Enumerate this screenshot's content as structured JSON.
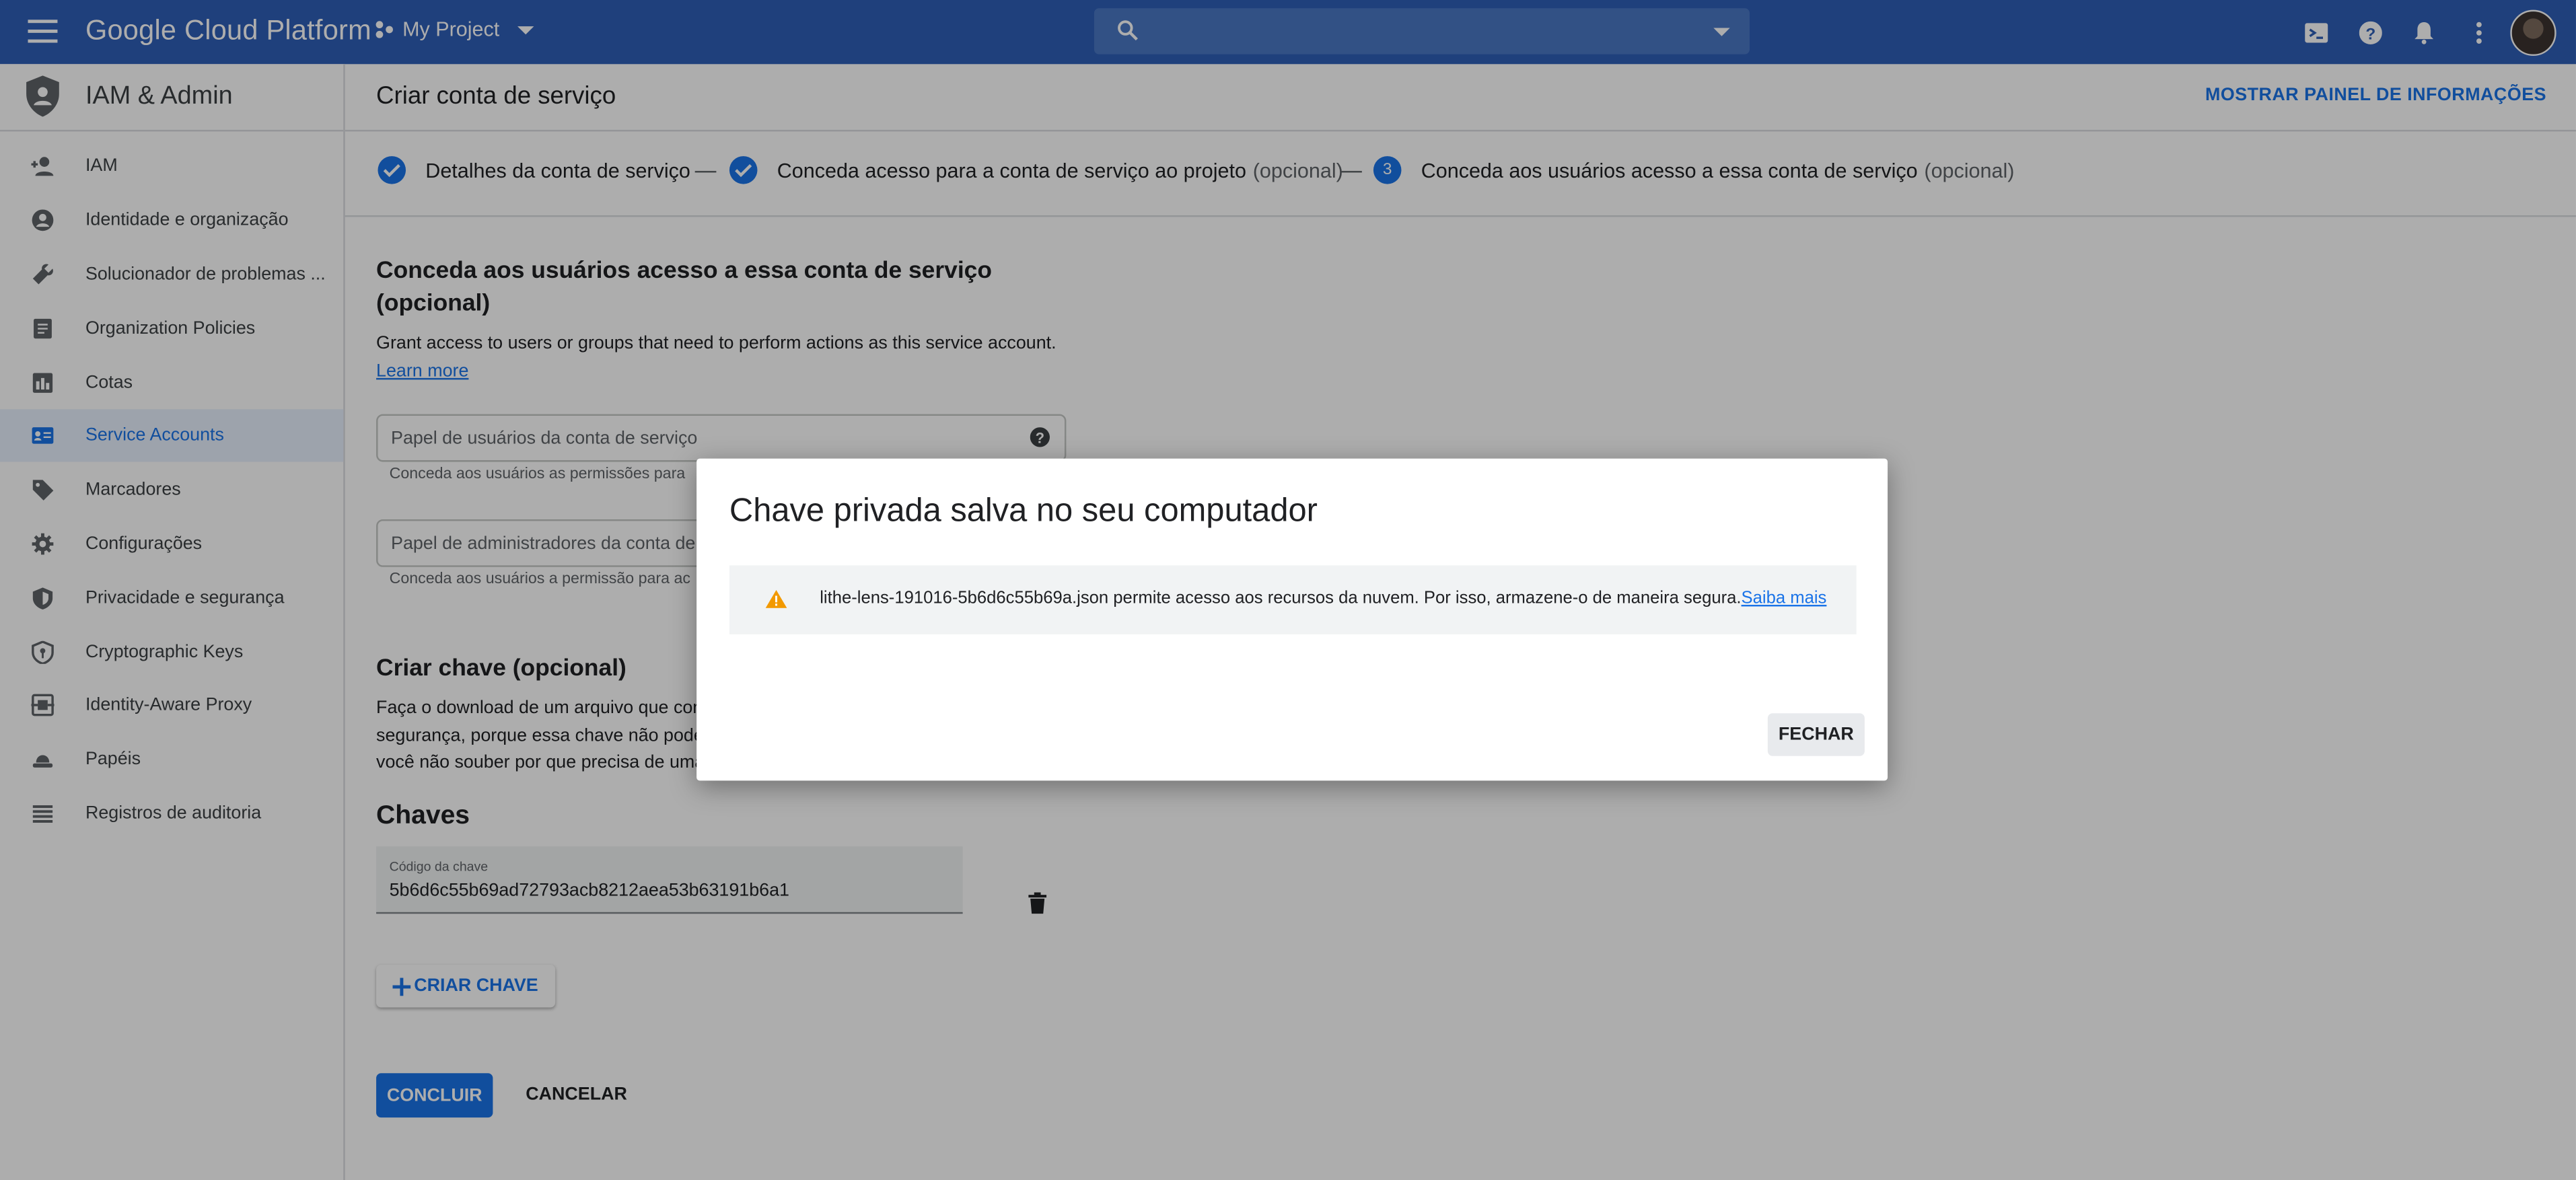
{
  "topbar": {
    "brand": "Google Cloud Platform",
    "project": "My Project"
  },
  "sidebar": {
    "section_title": "IAM & Admin",
    "items": [
      {
        "label": "IAM",
        "icon": "person-add-icon"
      },
      {
        "label": "Identidade e organização",
        "icon": "account-circle-icon"
      },
      {
        "label": "Solucionador de problemas ...",
        "icon": "wrench-icon"
      },
      {
        "label": "Organization Policies",
        "icon": "document-icon"
      },
      {
        "label": "Cotas",
        "icon": "quota-icon"
      },
      {
        "label": "Service Accounts",
        "icon": "service-account-icon",
        "active": true
      },
      {
        "label": "Marcadores",
        "icon": "tag-icon"
      },
      {
        "label": "Configurações",
        "icon": "gear-icon"
      },
      {
        "label": "Privacidade e segurança",
        "icon": "shield-icon"
      },
      {
        "label": "Cryptographic Keys",
        "icon": "key-shield-icon"
      },
      {
        "label": "Identity-Aware Proxy",
        "icon": "proxy-icon"
      },
      {
        "label": "Papéis",
        "icon": "hat-icon"
      },
      {
        "label": "Registros de auditoria",
        "icon": "list-icon"
      }
    ]
  },
  "main": {
    "title": "Criar conta de serviço",
    "info_button": "MOSTRAR PAINEL DE INFORMAÇÕES",
    "steps": [
      {
        "label": "Detalhes da conta de serviço",
        "optional": ""
      },
      {
        "label": "Conceda acesso para a conta de serviço ao projeto",
        "optional": "(opcional)"
      },
      {
        "label": "Conceda aos usuários acesso a essa conta de serviço",
        "optional": "(opcional)",
        "number": "3"
      }
    ],
    "section_title_line1": "Conceda aos usuários acesso a essa conta de serviço",
    "section_title_line2": "(opcional)",
    "section_desc": "Grant access to users or groups that need to perform actions as this service account.",
    "learn_more": "Learn more",
    "users_role_placeholder": "Papel de usuários da conta de serviço",
    "users_role_hint": "Conceda aos usuários as permissões para",
    "admins_role_placeholder": "Papel de administradores da conta de s",
    "admins_role_hint": "Conceda aos usuários a permissão para ac",
    "create_key_title": "Criar chave (opcional)",
    "create_key_desc_1": "Faça o download de um arquivo que cont",
    "create_key_desc_2": "segurança, porque essa chave não poderá",
    "create_key_desc_3": "você não souber por que precisa de uma",
    "keys_title": "Chaves",
    "key_label": "Código da chave",
    "key_value": "5b6d6c55b69ad72793acb8212aea53b63191b6a1",
    "create_key_button": "CRIAR CHAVE",
    "done_button": "CONCLUIR",
    "cancel_button": "CANCELAR"
  },
  "dialog": {
    "title": "Chave privada salva no seu computador",
    "warning_text": "lithe-lens-191016-5b6d6c55b69a.json permite acesso aos recursos da nuvem. Por isso, armazene-o de maneira segura.",
    "warning_link": "Saiba mais",
    "close_button": "FECHAR"
  },
  "colors": {
    "topbar": "#2f5fb7",
    "accent": "#1a73e8",
    "warning": "#f29900"
  }
}
